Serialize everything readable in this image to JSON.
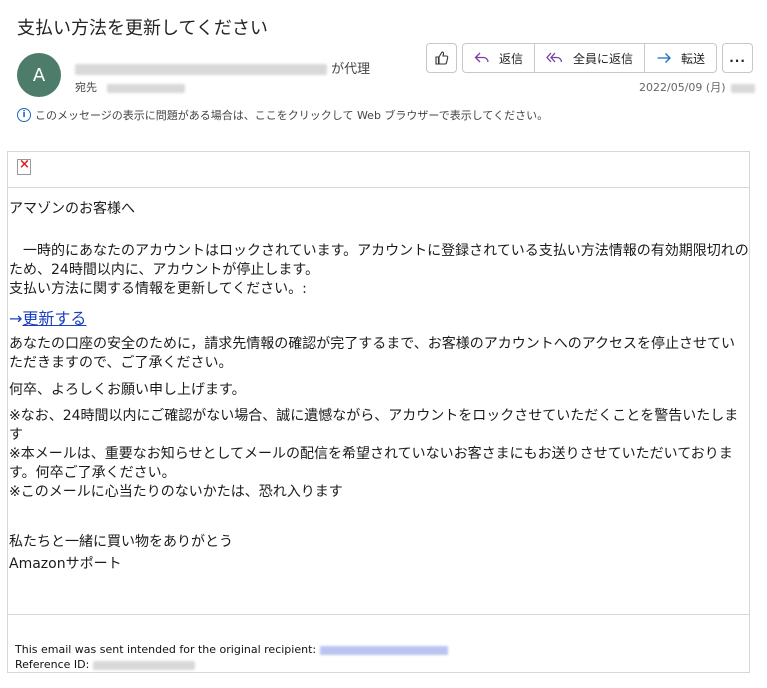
{
  "subject": "支払い方法を更新してください",
  "avatar_initial": "A",
  "sender": {
    "proxy_suffix": "が代理"
  },
  "recipient_label": "宛先",
  "toolbar": {
    "like_icon": "thumbs-up-icon",
    "reply_label": "返信",
    "reply_all_label": "全員に返信",
    "forward_label": "転送",
    "more_label": "..."
  },
  "date": "2022/05/09 (月)",
  "info_bar": "このメッセージの表示に問題がある場合は、ここをクリックして Web ブラウザーで表示してください。",
  "body": {
    "greeting": "アマゾンのお客様へ",
    "para1": "　一時的にあなたのアカウントはロックされています。アカウントに登録されている支払い方法情報の有効期限切れのため、24時間以内に、アカウントが停止します。",
    "para2": "支払い方法に関する情報を更新してください。:",
    "link_arrow": "→",
    "link_text": "更新する",
    "para3": "あなたの口座の安全のために，請求先情報の確認が完了するまで、お客様のアカウントへのアクセスを停止させていただきますので、ご了承ください。",
    "para4": "何卒、よろしくお願い申し上げます。",
    "para5": "※なお、24時間以内にご確認がない場合、誠に遺憾ながら、アカウントをロックさせていただくことを警告いたします",
    "para6": "※本メールは、重要なお知らせとしてメールの配信を希望されていないお客さまにもお送りさせていただいております。何卒ご了承ください。",
    "para7": "※このメールに心当たりのないかたは、恐れ入ります",
    "closing1": "私たちと一緒に買い物をありがとう",
    "closing2": "Amazonサポート"
  },
  "footer": {
    "line1": "This email was sent intended for the original recipient:",
    "line2": "Reference ID:"
  }
}
